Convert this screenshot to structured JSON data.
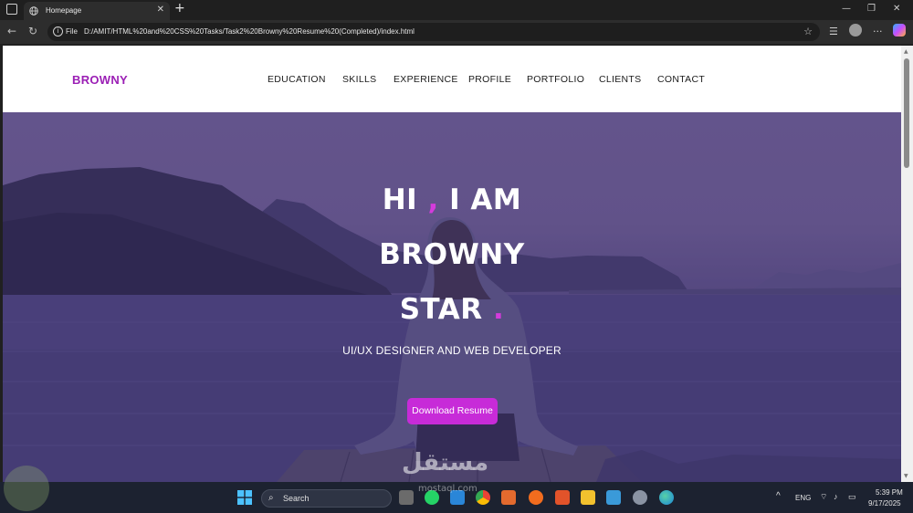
{
  "browser": {
    "tab_title": "Homepage",
    "new_tab": "+",
    "address_label": "File",
    "url": "D:/AMIT/HTML%20and%20CSS%20Tasks/Task2%20Browny%20Resume%20(Completed)/index.html"
  },
  "site": {
    "logo": "BROWNY",
    "nav": [
      "EDUCATION",
      "SKILLS",
      "EXPERIENCE",
      "PROFILE",
      "PORTFOLIO",
      "CLIENTS",
      "CONTACT"
    ],
    "hero": {
      "line1_a": "HI",
      "line1_dot": ",",
      "line1_b": "I AM",
      "line2": "BROWNY",
      "line3": "STAR",
      "line3_dot": ".",
      "subtitle": "UI/UX DESIGNER AND WEB DEVELOPER",
      "button": "Download Resume"
    },
    "accent_color": "#c72bd8"
  },
  "taskbar": {
    "search_label": "Search",
    "language": "ENG",
    "time": "5:39 PM",
    "date": "9/17/2025"
  },
  "watermark": {
    "text": "مستقل",
    "sub": "mostaql.com"
  }
}
